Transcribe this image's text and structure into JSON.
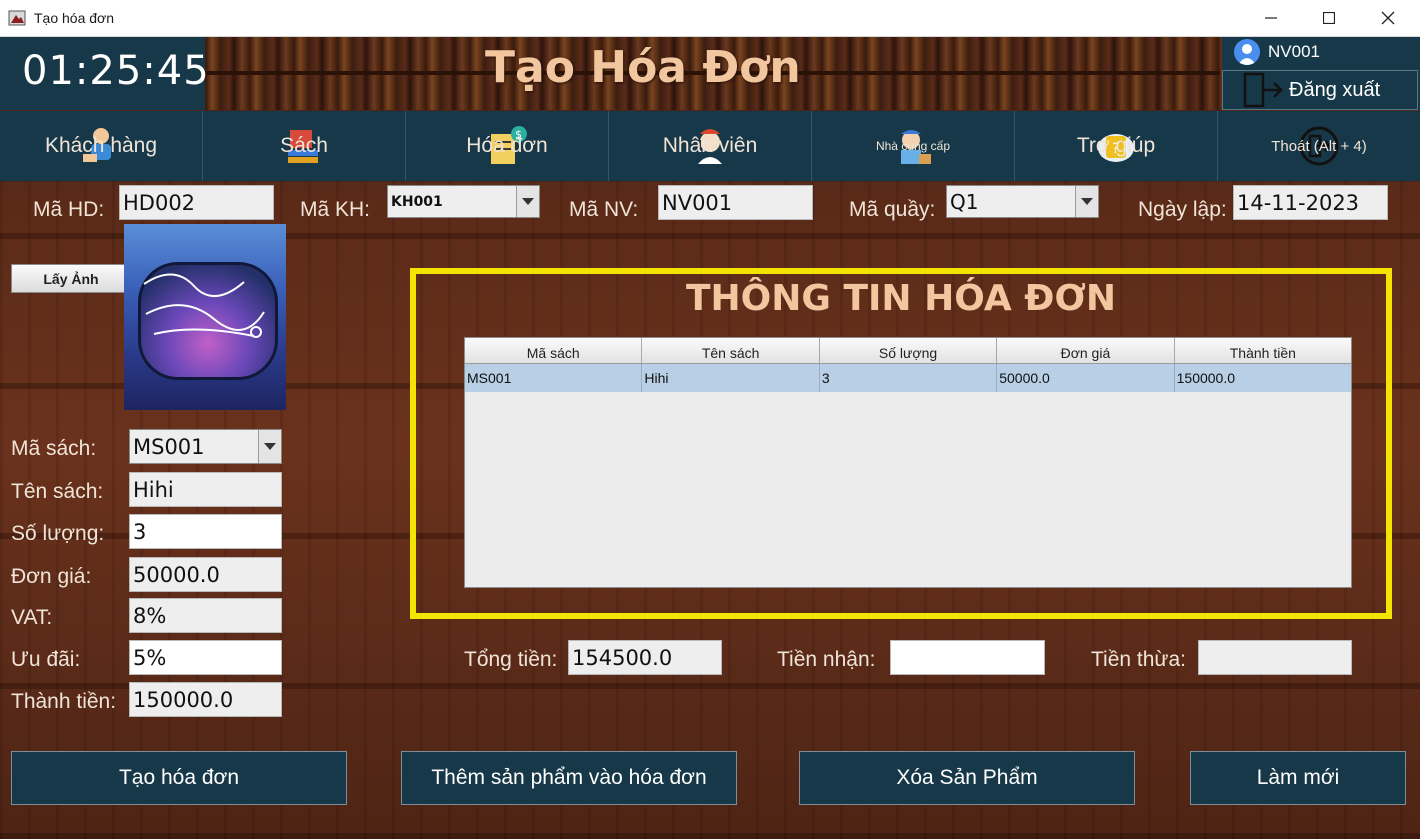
{
  "window": {
    "title": "Tạo hóa đơn"
  },
  "header": {
    "clock": "01:25:45",
    "page_title": "Tạo Hóa Đơn",
    "user": "NV001",
    "logout_label": "Đăng xuất"
  },
  "nav": {
    "items": [
      {
        "label": "Khách hàng",
        "icon": "customer-icon"
      },
      {
        "label": "Sách",
        "icon": "books-icon"
      },
      {
        "label": "Hóa đơn",
        "icon": "invoice-icon"
      },
      {
        "label": "Nhân viên",
        "icon": "employee-icon"
      },
      {
        "label": "Nhà cung cấp",
        "icon": "supplier-icon"
      },
      {
        "label": "Trợ giúp",
        "icon": "help-icon"
      },
      {
        "label": "Thoát (Alt + 4)",
        "icon": "exit-icon"
      }
    ]
  },
  "invoice": {
    "ma_hd_label": "Mã HD:",
    "ma_hd": "HD002",
    "ma_kh_label": "Mã KH:",
    "ma_kh": "KH001",
    "ma_nv_label": "Mã NV:",
    "ma_nv": "NV001",
    "ma_quay_label": "Mã quầy:",
    "ma_quay": "Q1",
    "ngay_lap_label": "Ngày lập:",
    "ngay_lap": "14-11-2023"
  },
  "product": {
    "get_image_label": "Lấy Ảnh",
    "ma_sach_label": "Mã sách:",
    "ma_sach": "MS001",
    "ten_sach_label": "Tên sách:",
    "ten_sach": "Hihi",
    "so_luong_label": "Số lượng:",
    "so_luong": "3",
    "don_gia_label": "Đơn giá:",
    "don_gia": "50000.0",
    "vat_label": "VAT:",
    "vat": "8%",
    "uu_dai_label": "Ưu đãi:",
    "uu_dai": "5%",
    "thanh_tien_label": "Thành tiền:",
    "thanh_tien": "150000.0"
  },
  "panel": {
    "title": "THÔNG TIN HÓA ĐƠN",
    "columns": [
      "Mã sách",
      "Tên sách",
      "Số lượng",
      "Đơn giá",
      "Thành tiền"
    ],
    "rows": [
      [
        "MS001",
        "Hihi",
        "3",
        "50000.0",
        "150000.0"
      ]
    ]
  },
  "totals": {
    "tong_tien_label": "Tổng tiền:",
    "tong_tien": "154500.0",
    "tien_nhan_label": "Tiền nhận:",
    "tien_nhan": "",
    "tien_thua_label": "Tiền thừa:",
    "tien_thua": ""
  },
  "actions": {
    "create": "Tạo hóa đơn",
    "add": "Thêm sản phẩm vào hóa đơn",
    "delete": "Xóa Sản Phẩm",
    "refresh": "Làm mới"
  },
  "colors": {
    "accent": "#173848",
    "panel_border": "#f4e400",
    "title_text": "#f2c7a0"
  }
}
